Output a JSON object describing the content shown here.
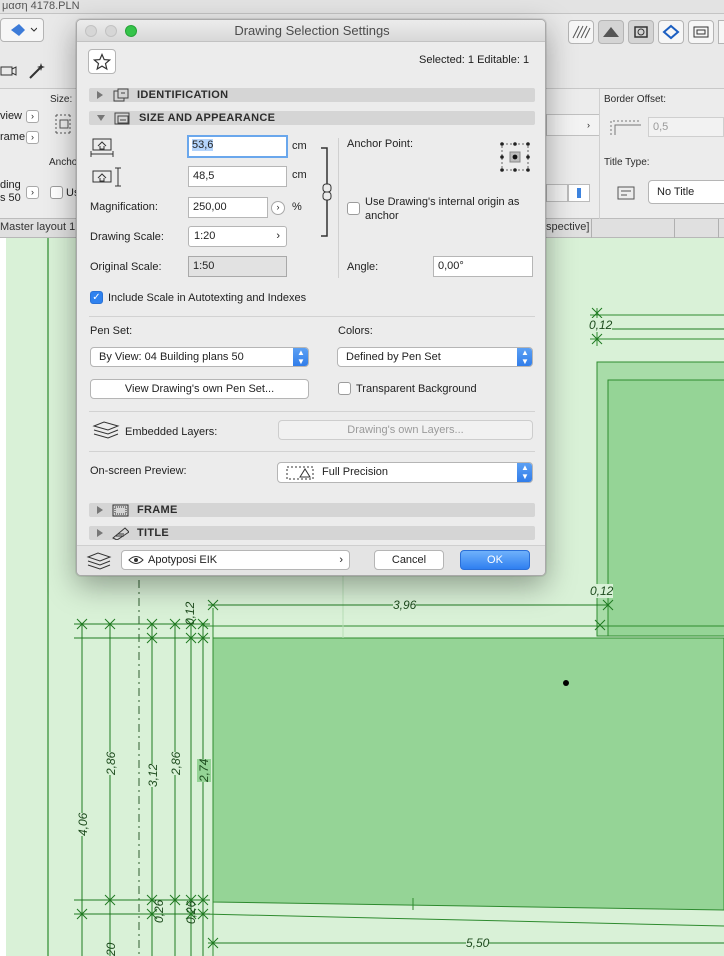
{
  "app": {
    "window_title": "μαση 4178.PLN",
    "tab_left": "Master layout 1",
    "tab_right": "spective]"
  },
  "infobox": {
    "size_label": "Size:",
    "view_label": "view",
    "frame_label": "rame",
    "anchor_label": "Ancho",
    "building_label": "ding",
    "plans_label": "s 50",
    "use_label": "Us",
    "border_offset_label": "Border Offset:",
    "border_offset_value": "0,5",
    "title_type_label": "Title Type:",
    "title_type_value": "No Title"
  },
  "dialog": {
    "title": "Drawing Selection Settings",
    "selected_text": "Selected: 1 Editable: 1",
    "sections": {
      "identification": "IDENTIFICATION",
      "size_appearance": "SIZE AND APPEARANCE",
      "frame": "FRAME",
      "title": "TITLE"
    },
    "width_value": "53,6",
    "height_value": "48,5",
    "unit_cm": "cm",
    "magnification_label": "Magnification:",
    "magnification_value": "250,00",
    "percent": "%",
    "drawing_scale_label": "Drawing Scale:",
    "drawing_scale_value": "1:20",
    "original_scale_label": "Original Scale:",
    "original_scale_value": "1:50",
    "anchor_point_label": "Anchor Point:",
    "internal_origin_label_1": "Use Drawing's internal origin as",
    "internal_origin_label_2": "anchor",
    "angle_label": "Angle:",
    "angle_value": "0,00°",
    "include_scale_label": "Include Scale in Autotexting and Indexes",
    "include_scale_checked": true,
    "pen_set_label": "Pen Set:",
    "pen_set_value": "By View: 04 Building plans 50",
    "colors_label": "Colors:",
    "colors_value": "Defined by Pen Set",
    "view_pen_set_button": "View Drawing's own Pen Set...",
    "transparent_bg_label": "Transparent Background",
    "embedded_layers_label": "Embedded Layers:",
    "drawing_layers_button": "Drawing's own Layers...",
    "preview_label": "On-screen Preview:",
    "preview_value": "Full Precision",
    "layer_value": "Apotyposi EIK",
    "cancel_button": "Cancel",
    "ok_button": "OK"
  },
  "drawing": {
    "dims": [
      "0,12",
      "0,12",
      "3,96",
      "0,12",
      "2,86",
      "3,12",
      "2,86",
      "2,74",
      "4,06",
      "0,26",
      "0,26",
      "5,50",
      "20"
    ]
  },
  "colors": {
    "accent": "#2f7ff0",
    "canvas": "#d9f1d7",
    "fill": "#95d496",
    "line": "#2e8b2f"
  }
}
